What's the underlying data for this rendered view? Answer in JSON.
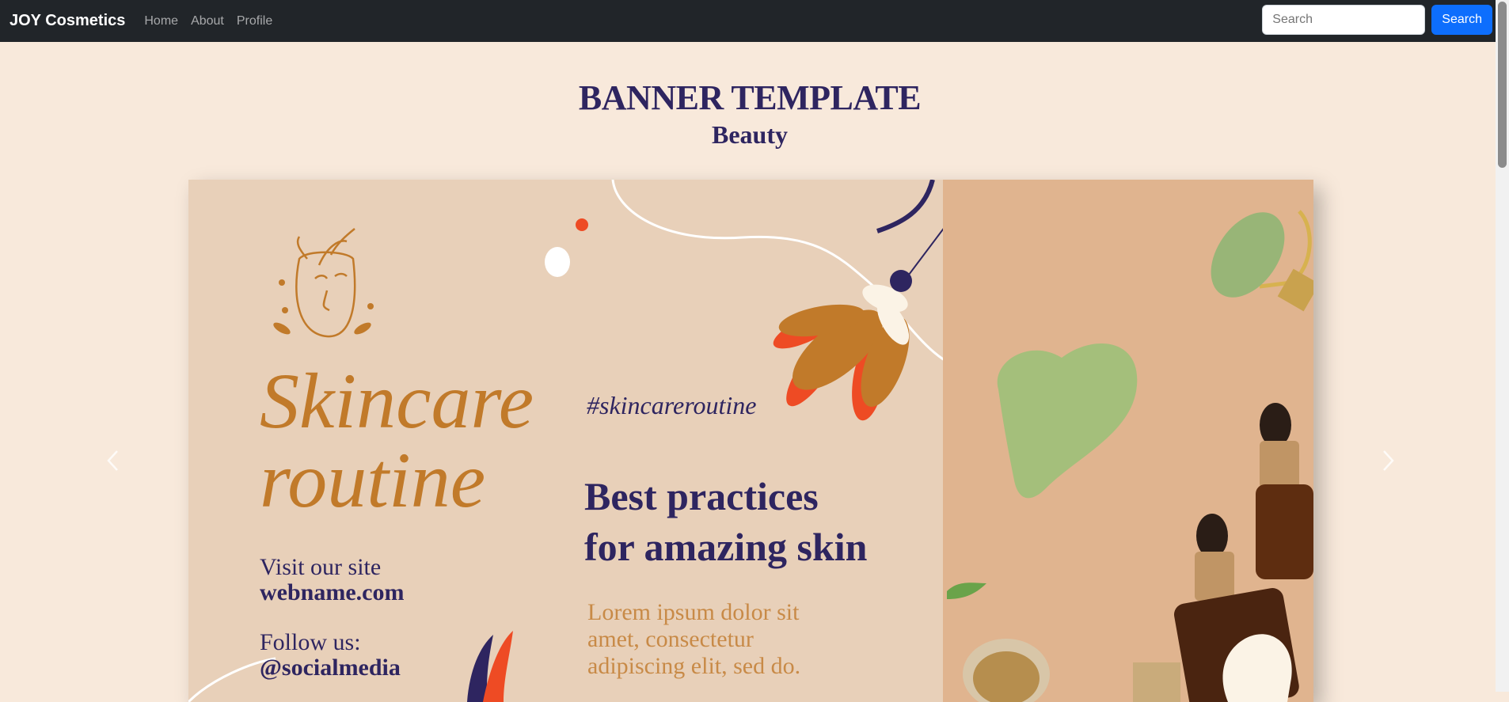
{
  "navbar": {
    "brand": "JOY Cosmetics",
    "links": [
      "Home",
      "About",
      "Profile"
    ],
    "search_placeholder": "Search",
    "search_button": "Search"
  },
  "header": {
    "title": "BANNER TEMPLATE",
    "subtitle": "Beauty"
  },
  "carousel": {
    "prev_icon": "chevron-left-icon",
    "next_icon": "chevron-right-icon",
    "banner": {
      "headline_line1": "Skincare",
      "headline_line2": "routine",
      "visit_label": "Visit our site",
      "visit_value": "webname.com",
      "follow_label": "Follow us:",
      "follow_value": "@socialmedia",
      "hashtag": "#skincareroutine",
      "tagline_line1": "Best practices",
      "tagline_line2": "for amazing skin",
      "lorem_line1": "Lorem ipsum dolor sit",
      "lorem_line2": "amet, consectetur",
      "lorem_line3": "adipiscing elit, sed do."
    }
  },
  "colors": {
    "navbar_bg": "#212529",
    "page_bg": "#f8e9db",
    "accent_blue": "#0d6efd",
    "navy": "#2e2560",
    "ochre": "#c17a2a",
    "red_orange": "#ee4b24"
  }
}
